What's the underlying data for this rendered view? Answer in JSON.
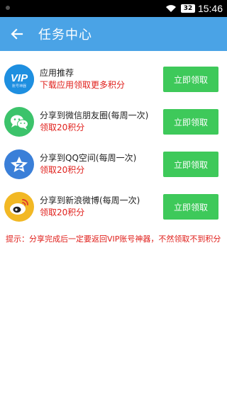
{
  "statusbar": {
    "battery": "32",
    "time": "15:46"
  },
  "appbar": {
    "title": "任务中心"
  },
  "tasks": [
    {
      "icon": "vip-app-icon",
      "vip_text": "VIP",
      "vip_sub": "账号神器",
      "title": "应用推荐",
      "subtitle": "下载应用领取更多积分",
      "button": "立即领取",
      "color": "#1e8fe0"
    },
    {
      "icon": "wechat-icon",
      "title": "分享到微信朋友圈(每周一次)",
      "subtitle": "领取20积分",
      "button": "立即领取",
      "color": "#3cc36b"
    },
    {
      "icon": "qzone-icon",
      "title": "分享到QQ空间(每周一次)",
      "subtitle": "领取20积分",
      "button": "立即领取",
      "color": "#3a7fd8"
    },
    {
      "icon": "weibo-icon",
      "title": "分享到新浪微博(每周一次)",
      "subtitle": "领取20积分",
      "button": "立即领取",
      "color": "#f2b824"
    }
  ],
  "tip": "提示：分享完成后一定要返回VIP账号神器，不然领取不到积分",
  "colors": {
    "appbar": "#4aa3e6",
    "button": "#3ec95a",
    "accent_red": "#e0201c"
  }
}
